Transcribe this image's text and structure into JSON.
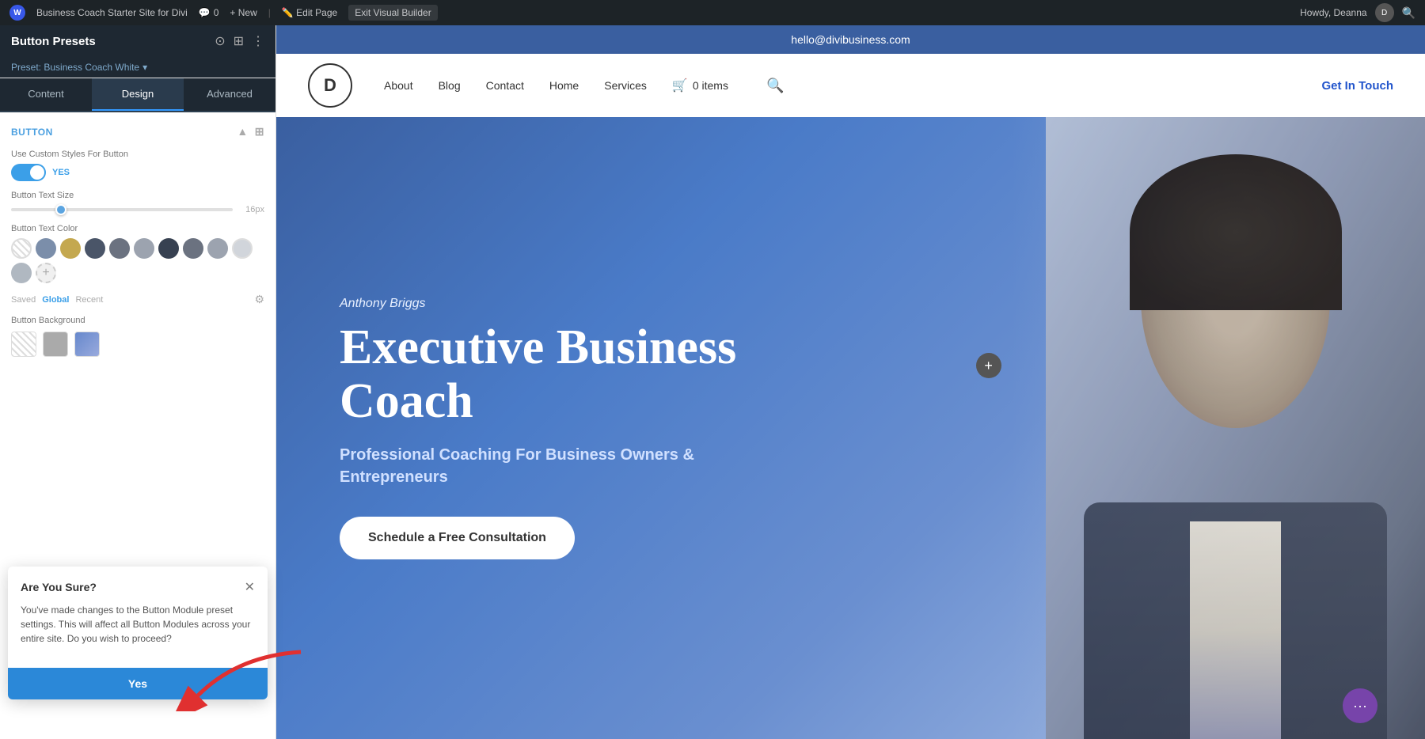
{
  "admin_bar": {
    "wp_logo": "W",
    "site_name": "Business Coach Starter Site for Divi",
    "comments_count": "0",
    "new_label": "+ New",
    "edit_label": "Edit Page",
    "exit_label": "Exit Visual Builder",
    "howdy": "Howdy, Deanna"
  },
  "sidebar": {
    "title": "Button Presets",
    "preset_label": "Preset: Business Coach White",
    "tabs": [
      {
        "id": "content",
        "label": "Content"
      },
      {
        "id": "design",
        "label": "Design"
      },
      {
        "id": "advanced",
        "label": "Advanced"
      }
    ],
    "active_tab": "design",
    "section_title": "Button",
    "fields": {
      "custom_styles_label": "Use Custom Styles For Button",
      "toggle_state": "YES",
      "button_text_size_label": "Button Text Size",
      "button_text_size_value": "16px",
      "button_text_color_label": "Button Text Color",
      "button_background_label": "Button Background"
    },
    "color_swatches": [
      {
        "color": "transparent",
        "label": "transparent",
        "bordered": true
      },
      {
        "color": "#7b8eaa",
        "label": "gray-blue"
      },
      {
        "color": "#c4a84f",
        "label": "gold"
      },
      {
        "color": "#4a5568",
        "label": "dark-gray"
      },
      {
        "color": "#6b7280",
        "label": "medium-gray"
      },
      {
        "color": "#9ca3af",
        "label": "light-gray"
      },
      {
        "color": "#374151",
        "label": "charcoal"
      },
      {
        "color": "#6b7280",
        "label": "gray2"
      },
      {
        "color": "#9ca3af",
        "label": "silver"
      },
      {
        "color": "#d1d5db",
        "label": "pale-gray",
        "bordered": true
      }
    ],
    "save_options": [
      "Saved",
      "Global",
      "Recent"
    ],
    "active_save": "Global",
    "confirm_dialog": {
      "title": "Are You Sure?",
      "message": "You've made changes to the Button Module preset settings. This will affect all Button Modules across your entire site. Do you wish to proceed?",
      "yes_label": "Yes"
    }
  },
  "website": {
    "email": "hello@divibusiness.com",
    "logo_letter": "D",
    "nav_links": [
      "About",
      "Blog",
      "Contact",
      "Home",
      "Services"
    ],
    "cart_items": "0 items",
    "cta_label": "Get In Touch",
    "hero": {
      "name": "Anthony Briggs",
      "title": "Executive Business Coach",
      "subtitle": "Professional Coaching For Business Owners & Entrepreneurs",
      "cta_button": "Schedule a Free Consultation"
    }
  }
}
